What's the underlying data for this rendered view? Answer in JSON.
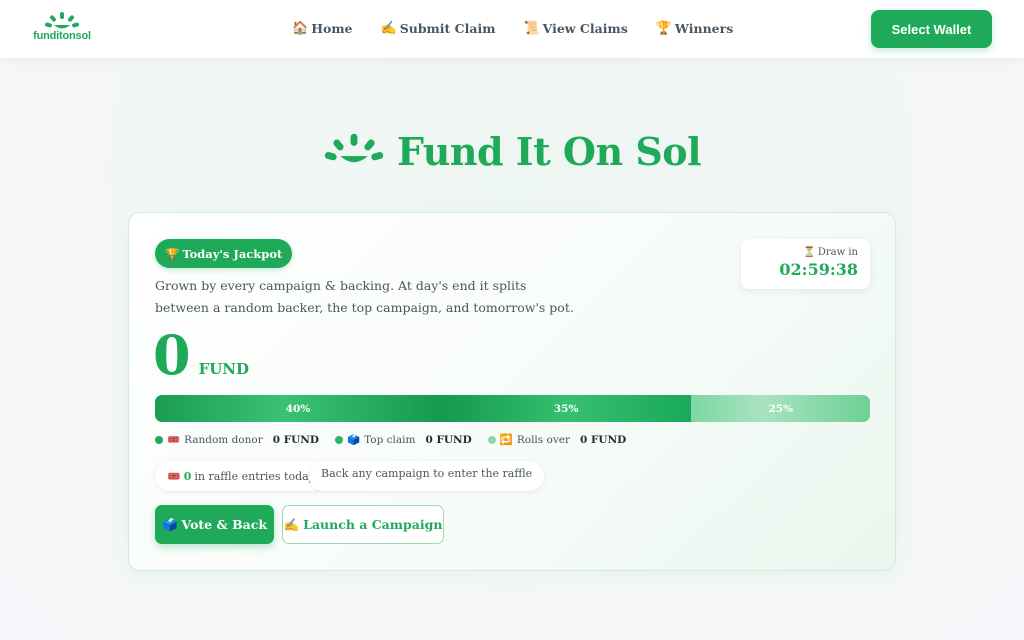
{
  "brand": {
    "name": "funditonsol",
    "color": "#1faa5a"
  },
  "nav": [
    {
      "icon": "🏠",
      "label": "Home"
    },
    {
      "icon": "✍️",
      "label": "Submit Claim"
    },
    {
      "icon": "📜",
      "label": "View Claims"
    },
    {
      "icon": "🏆",
      "label": "Winners"
    }
  ],
  "header": {
    "wallet_label": "Select Wallet"
  },
  "hero": {
    "title": "Fund It On Sol"
  },
  "jackpot": {
    "badge_icon": "🏆",
    "badge_label": "Today's Jackpot",
    "description": "Grown by every campaign & backing. At day's end it splits between a random backer, the top campaign, and tomorrow's pot.",
    "timer_icon": "⏳",
    "timer_label": "Draw in",
    "timer_value": "02:59:38",
    "amount": "0",
    "unit": "FUND",
    "split": [
      {
        "label": "40%",
        "share": 40
      },
      {
        "label": "35%",
        "share": 35
      },
      {
        "label": "25%",
        "share": 25
      }
    ],
    "legend": [
      {
        "color": "#1faa5a",
        "icon": "🎟️",
        "label": "Random donor",
        "value": "0 FUND"
      },
      {
        "color": "#2bb565",
        "icon": "🗳️",
        "label": "Top claim",
        "value": "0 FUND"
      },
      {
        "color": "#8fd8ae",
        "icon": "🔁",
        "label": "Rolls over",
        "value": "0 FUND"
      }
    ],
    "raffle": {
      "icon": "🎟️",
      "count": "0",
      "suffix": "in raffle entries today"
    },
    "hint": "Back any campaign to enter the raffle",
    "vote_button": {
      "icon": "🗳️",
      "label": "Vote & Back"
    },
    "launch_button": {
      "icon": "✍️",
      "label": "Launch a Campaign"
    }
  }
}
